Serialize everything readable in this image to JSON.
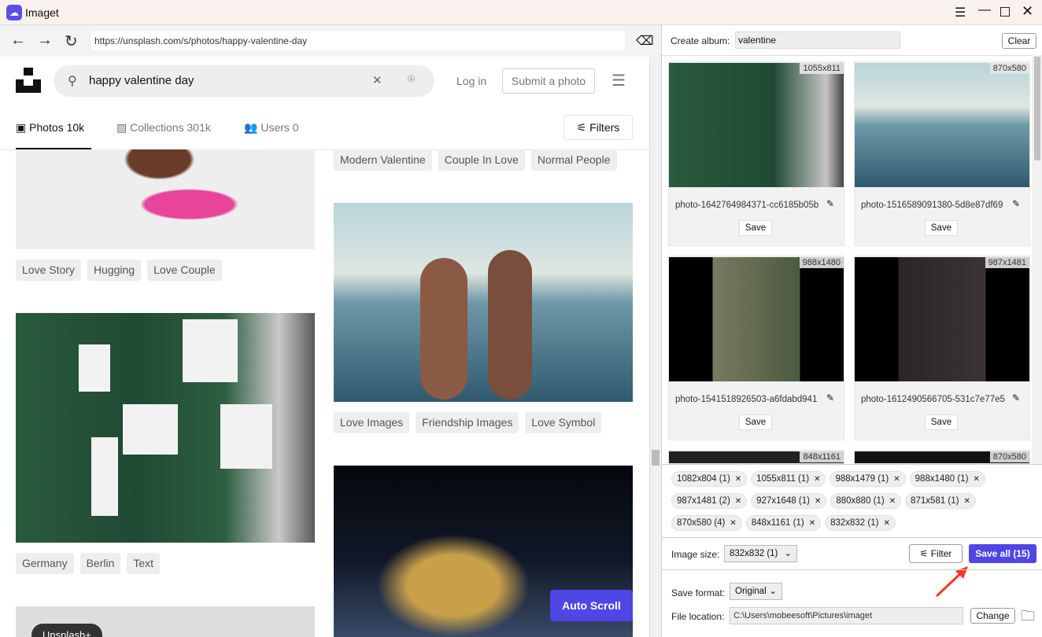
{
  "app": {
    "title": "Imaget",
    "accent": "#4f46e5"
  },
  "browser": {
    "url": "https://unsplash.com/s/photos/happy-valentine-day"
  },
  "site": {
    "search_value": "happy valentine day",
    "login": "Log in",
    "submit": "Submit a photo",
    "tabs": [
      {
        "label": "Photos 10k"
      },
      {
        "label": "Collections 301k"
      },
      {
        "label": "Users 0"
      }
    ],
    "filters": "Filters",
    "col1_tags_a": [
      "Love Story",
      "Hugging",
      "Love Couple"
    ],
    "col1_tags_b": [
      "Germany",
      "Berlin",
      "Text"
    ],
    "col2_tags_a": [
      "Modern Valentine",
      "Couple In Love",
      "Normal People"
    ],
    "col2_tags_b": [
      "Love Images",
      "Friendship Images",
      "Love Symbol"
    ],
    "unsplash_plus": "Unsplash+",
    "auto_scroll": "Auto Scroll"
  },
  "panel": {
    "create_album_label": "Create album:",
    "album_value": "valentine",
    "clear": "Clear",
    "cards": [
      {
        "dim": "1055x811",
        "name": "photo-1642764984371-cc6185b05b",
        "save": "Save"
      },
      {
        "dim": "870x580",
        "name": "photo-1516589091380-5d8e87df69",
        "save": "Save"
      },
      {
        "dim": "988x1480",
        "name": "photo-1541518926503-a6fdabd941",
        "save": "Save"
      },
      {
        "dim": "987x1481",
        "name": "photo-1612490566705-531c7e77e5",
        "save": "Save"
      },
      {
        "dim": "848x1161"
      },
      {
        "dim": "870x580"
      }
    ],
    "chips": [
      "1082x804 (1)",
      "1055x811 (1)",
      "988x1479 (1)",
      "988x1480 (1)",
      "987x1481 (2)",
      "927x1648 (1)",
      "880x880 (1)",
      "871x581 (1)",
      "870x580 (4)",
      "848x1161 (1)",
      "832x832 (1)"
    ],
    "image_size_label": "Image size:",
    "image_size_value": "832x832 (1)",
    "filter": "Filter",
    "save_all": "Save all (15)",
    "save_format_label": "Save format:",
    "save_format_value": "Original",
    "file_location_label": "File location:",
    "file_location_value": "C:\\Users\\mobeesoft\\Pictures\\imaget",
    "change": "Change"
  }
}
